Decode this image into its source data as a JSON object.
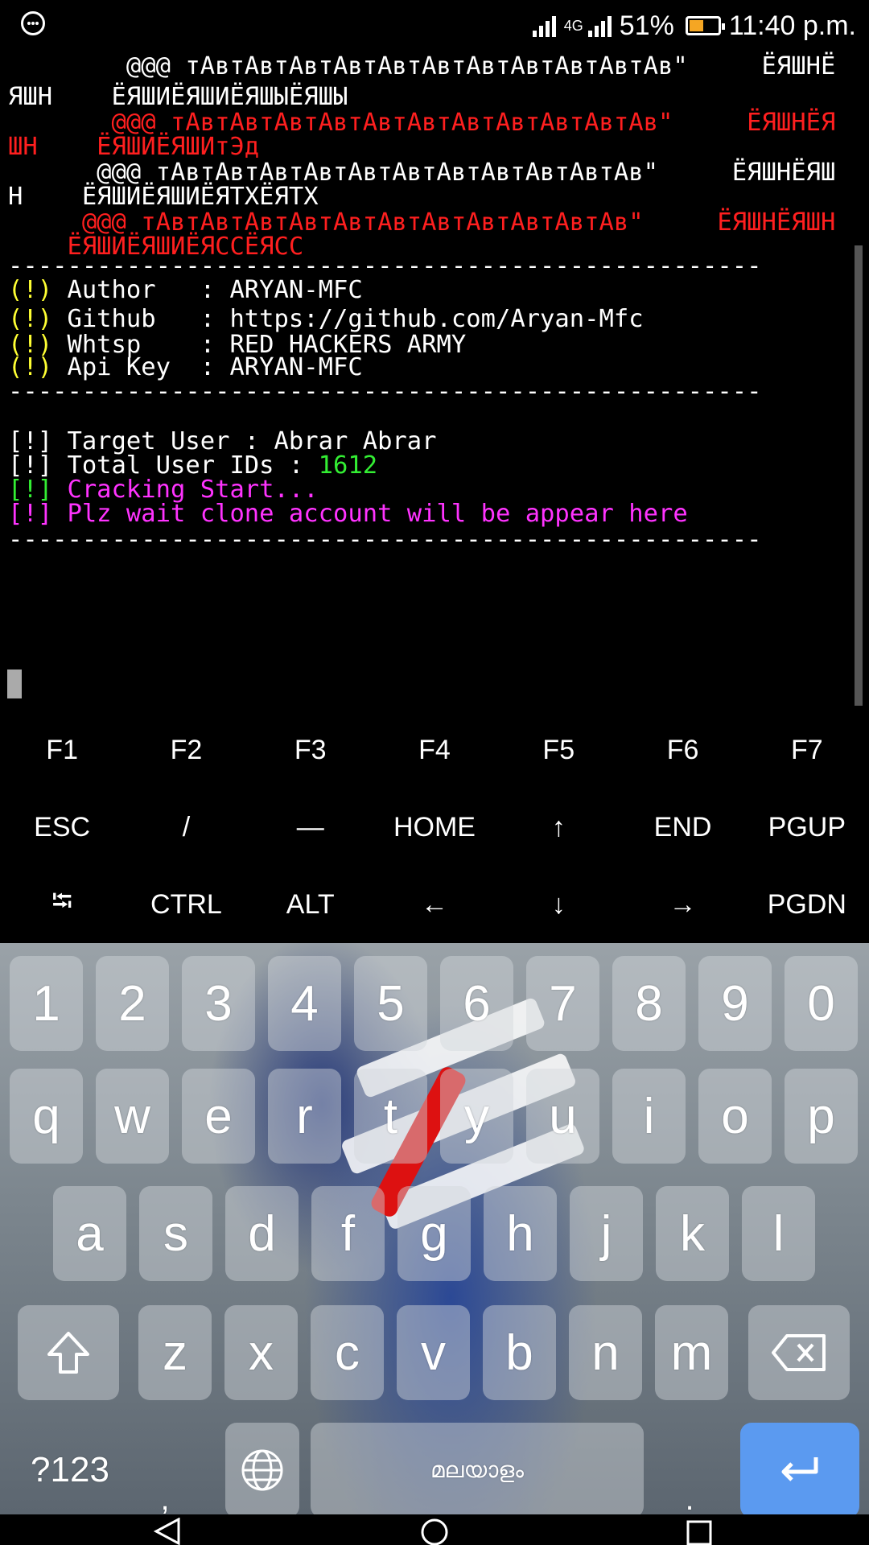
{
  "status_bar": {
    "network": "4G",
    "battery": "51%",
    "battery_level": 0.51,
    "time": "11:40 p.m."
  },
  "terminal": {
    "lines": [
      {
        "text": "        @@@ тАвтАвтАвтАвтАвтАвтАвтАвтАвтАвтАв\"     ЁЯШНЁ",
        "color": "white"
      },
      {
        "text": "ЯШН    ЁЯШИЁЯШИЁЯШЫЁЯШЫ",
        "color": "white"
      },
      {
        "text": "       @@@ тАвтАвтАвтАвтАвтАвтАвтАвтАвтАвтАв\"     ЁЯШНЁЯ",
        "color": "red"
      },
      {
        "text": "ШН    ЁЯШИЁЯШИтЭд",
        "color": "red"
      },
      {
        "text": "      @@@ тАвтАвтАвтАвтАвтАвтАвтАвтАвтАвтАв\"     ЁЯШНЁЯШ",
        "color": "white"
      },
      {
        "text": "Н    ЁЯШИЁЯШИЁЯТХЁЯТХ",
        "color": "white"
      },
      {
        "text": "     @@@ тАвтАвтАвтАвтАвтАвтАвтАвтАвтАвтАв\"     ЁЯШНЁЯШН",
        "color": "red"
      },
      {
        "text": "    ЁЯШИЁЯШИЁЯССЁЯСС",
        "color": "red"
      },
      {
        "text": "---------------------------------------------------",
        "color": "white"
      },
      {
        "prefix": "(!)",
        "text": " Author   : ARYAN-MFC",
        "prefix_color": "yellow"
      },
      {
        "prefix": "(!)",
        "text": " Github   : https://github.com/Aryan-Mfc",
        "prefix_color": "yellow"
      },
      {
        "prefix": "(!)",
        "text": " Whtsp    : RED HACKERS ARMY",
        "prefix_color": "yellow"
      },
      {
        "prefix": "(!)",
        "text": " Api Key  : ARYAN-MFC",
        "prefix_color": "yellow"
      },
      {
        "text": "---------------------------------------------------",
        "color": "white"
      },
      {
        "text": "",
        "color": "white"
      },
      {
        "prefix": "[!]",
        "text": " Target User : Abrar Abrar",
        "prefix_color": "white"
      },
      {
        "prefix": "[!]",
        "text": " Total User IDs : ",
        "prefix_color": "white",
        "value": "1612",
        "value_color": "green"
      },
      {
        "prefix": "[!]",
        "text": " Cracking Start...",
        "prefix_color": "green",
        "color": "magenta"
      },
      {
        "prefix": "[!]",
        "text": " Plz wait clone account will be appear here",
        "prefix_color": "magenta",
        "color": "magenta"
      },
      {
        "text": "---------------------------------------------------",
        "color": "white"
      }
    ]
  },
  "extra_keys": {
    "row1": [
      "F1",
      "F2",
      "F3",
      "F4",
      "F5",
      "F6",
      "F7"
    ],
    "row2": [
      "ESC",
      "/",
      "—",
      "HOME",
      "↑",
      "END",
      "PGUP"
    ],
    "row3": [
      "⭾",
      "CTRL",
      "ALT",
      "←",
      "↓",
      "→",
      "PGDN"
    ]
  },
  "keyboard": {
    "numbers": [
      "1",
      "2",
      "3",
      "4",
      "5",
      "6",
      "7",
      "8",
      "9",
      "0"
    ],
    "row1": [
      "q",
      "w",
      "e",
      "r",
      "t",
      "y",
      "u",
      "i",
      "o",
      "p"
    ],
    "row2": [
      "a",
      "s",
      "d",
      "f",
      "g",
      "h",
      "j",
      "k",
      "l"
    ],
    "row3": [
      "z",
      "x",
      "c",
      "v",
      "b",
      "n",
      "m"
    ],
    "symbols_label": "?123",
    "comma": ",",
    "space_label": "മലയാളം",
    "period": ".",
    "icons": [
      "shift-icon",
      "backspace-icon",
      "globe-icon",
      "enter-icon"
    ],
    "enter_color": "#5b9af0"
  },
  "nav_bar": {
    "icons": [
      "back-icon",
      "home-icon",
      "recents-icon"
    ]
  }
}
